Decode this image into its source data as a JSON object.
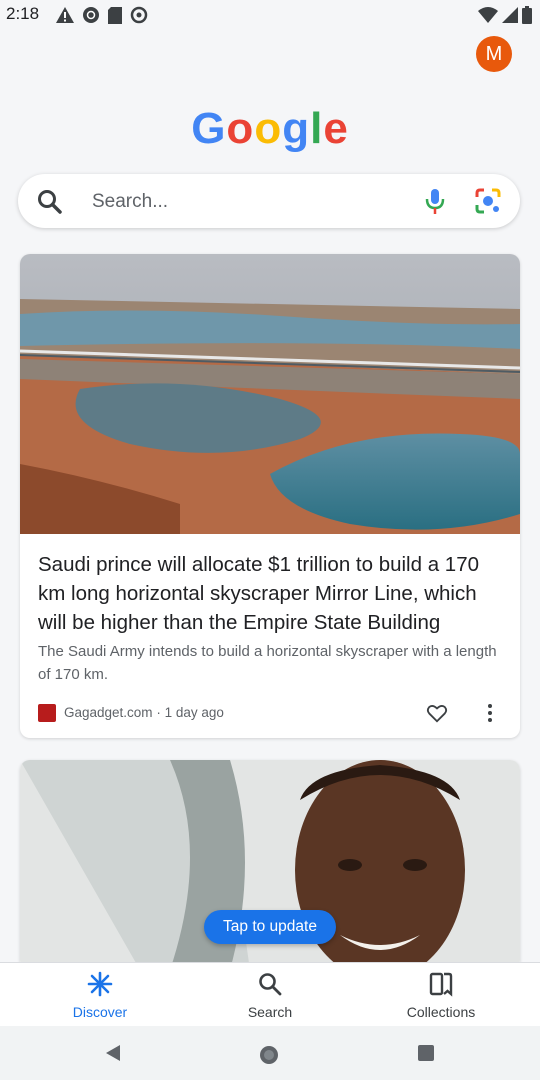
{
  "status_bar": {
    "time": "2:18",
    "left_icons": [
      "warning-icon",
      "vpn-icon",
      "sd-card-icon",
      "sync-icon"
    ],
    "right_icons": [
      "wifi-icon",
      "signal-icon",
      "battery-icon"
    ]
  },
  "header": {
    "avatar_letter": "M",
    "avatar_color": "#e8590c",
    "logo_letters": [
      "G",
      "o",
      "o",
      "g",
      "l",
      "e"
    ],
    "logo_colors": [
      "#4285f4",
      "#ea4335",
      "#fbbc05",
      "#4285f4",
      "#34a853",
      "#ea4335"
    ]
  },
  "search": {
    "placeholder": "Search...",
    "icons": [
      "search-icon",
      "mic-icon",
      "lens-icon"
    ]
  },
  "feed": {
    "cards": [
      {
        "title": "Saudi prince will allocate $1 trillion to build a 170 km long horizontal skyscraper Mirror Line, which will be higher than the Empire State Building",
        "snippet": "The Saudi Army intends to build a horizontal skyscraper with a length of 170 km.",
        "source": "Gagadget.com",
        "age": "1 day ago",
        "image": "desert-lake-mirror-skyscraper-photo"
      },
      {
        "image": "portrait-photo"
      }
    ],
    "update_button": "Tap to update"
  },
  "bottom_nav": {
    "items": [
      {
        "label": "Discover",
        "icon": "discover-icon",
        "active": true
      },
      {
        "label": "Search",
        "icon": "search-icon",
        "active": false
      },
      {
        "label": "Collections",
        "icon": "collections-icon",
        "active": false
      }
    ],
    "accent": "#1a73e8"
  },
  "system_nav": [
    "back-icon",
    "home-icon",
    "recents-icon"
  ]
}
